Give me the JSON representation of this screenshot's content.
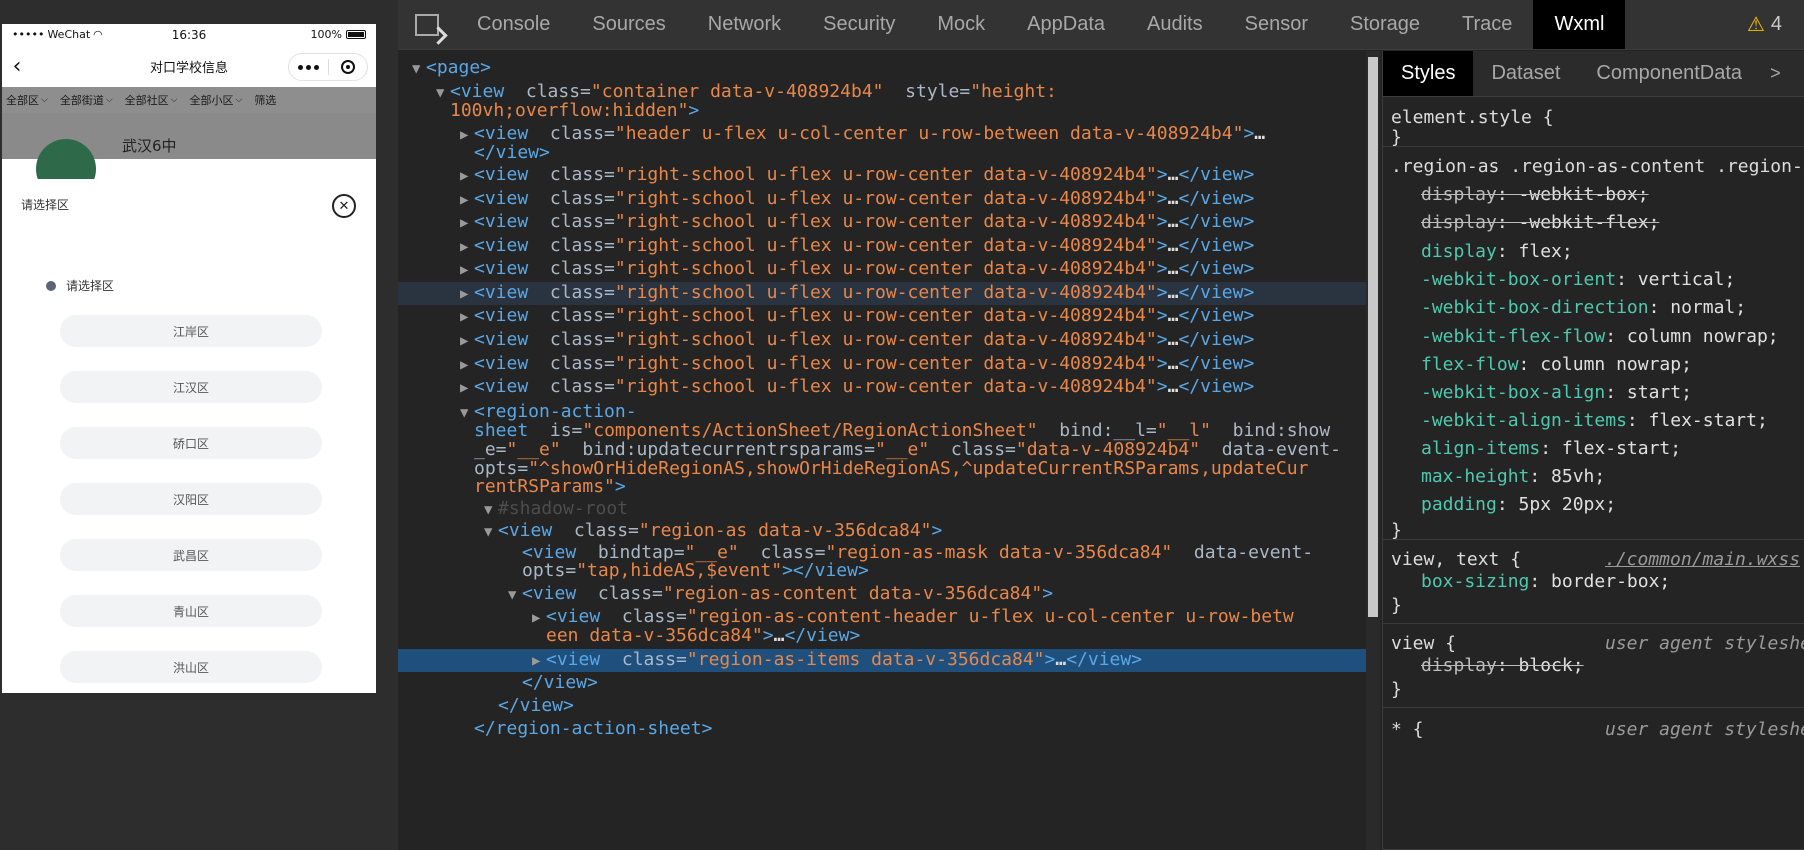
{
  "phone": {
    "status": {
      "carrier": "WeChat",
      "time": "16:36",
      "battery": "100%"
    },
    "nav": {
      "back": "‹",
      "title": "对口学校信息"
    },
    "filters": [
      "全部区",
      "全部街道",
      "全部社区",
      "全部小区",
      "筛选"
    ],
    "school_name": "武汉6中",
    "sheet": {
      "title": "请选择区",
      "close": "✕",
      "subtitle": "请选择区",
      "items": [
        "江岸区",
        "江汉区",
        "硚口区",
        "汉阳区",
        "武昌区",
        "青山区",
        "洪山区"
      ]
    }
  },
  "devtools": {
    "tabs": [
      "Console",
      "Sources",
      "Network",
      "Security",
      "Mock",
      "AppData",
      "Audits",
      "Sensor",
      "Storage",
      "Trace",
      "Wxml"
    ],
    "active_tab": "Wxml",
    "warnings": "4",
    "tree": [
      {
        "tri": "▼",
        "indent": 0,
        "parts": [
          [
            "tg",
            "<page>"
          ]
        ]
      },
      {
        "tri": "▼",
        "indent": 1,
        "parts": [
          [
            "tg",
            "<view "
          ],
          [
            "an",
            " class="
          ],
          [
            "av",
            "\"container data-v-408924b4\""
          ],
          [
            "an",
            "  style="
          ],
          [
            "av",
            "\"height:"
          ]
        ]
      },
      {
        "tri": "",
        "indent": 1,
        "parts": [
          [
            "av",
            "100vh;overflow:hidden\""
          ],
          [
            "tg",
            ">"
          ]
        ]
      },
      {
        "tri": "▶",
        "indent": 2,
        "parts": [
          [
            "tg",
            "<view "
          ],
          [
            "an",
            " class="
          ],
          [
            "av",
            "\"header u-flex u-col-center u-row-between data-v-408924b4\""
          ],
          [
            "tg",
            ">"
          ],
          [
            "el",
            "…"
          ]
        ]
      },
      {
        "tri": "",
        "indent": 2,
        "parts": [
          [
            "tg",
            "</view>"
          ]
        ]
      },
      {
        "tri": "▶",
        "indent": 2,
        "parts": [
          [
            "tg",
            "<view "
          ],
          [
            "an",
            " class="
          ],
          [
            "av",
            "\"right-school u-flex u-row-center data-v-408924b4\""
          ],
          [
            "tg",
            ">"
          ],
          [
            "el",
            "…"
          ],
          [
            "tg",
            "</view>"
          ]
        ]
      },
      {
        "tri": "▶",
        "indent": 2,
        "parts": [
          [
            "tg",
            "<view "
          ],
          [
            "an",
            " class="
          ],
          [
            "av",
            "\"right-school u-flex u-row-center data-v-408924b4\""
          ],
          [
            "tg",
            ">"
          ],
          [
            "el",
            "…"
          ],
          [
            "tg",
            "</view>"
          ]
        ]
      },
      {
        "tri": "▶",
        "indent": 2,
        "parts": [
          [
            "tg",
            "<view "
          ],
          [
            "an",
            " class="
          ],
          [
            "av",
            "\"right-school u-flex u-row-center data-v-408924b4\""
          ],
          [
            "tg",
            ">"
          ],
          [
            "el",
            "…"
          ],
          [
            "tg",
            "</view>"
          ]
        ]
      },
      {
        "tri": "▶",
        "indent": 2,
        "parts": [
          [
            "tg",
            "<view "
          ],
          [
            "an",
            " class="
          ],
          [
            "av",
            "\"right-school u-flex u-row-center data-v-408924b4\""
          ],
          [
            "tg",
            ">"
          ],
          [
            "el",
            "…"
          ],
          [
            "tg",
            "</view>"
          ]
        ]
      },
      {
        "tri": "▶",
        "indent": 2,
        "parts": [
          [
            "tg",
            "<view "
          ],
          [
            "an",
            " class="
          ],
          [
            "av",
            "\"right-school u-flex u-row-center data-v-408924b4\""
          ],
          [
            "tg",
            ">"
          ],
          [
            "el",
            "…"
          ],
          [
            "tg",
            "</view>"
          ]
        ]
      },
      {
        "tri": "▶",
        "indent": 2,
        "hover": true,
        "parts": [
          [
            "tg",
            "<view "
          ],
          [
            "an",
            " class="
          ],
          [
            "av",
            "\"right-school u-flex u-row-center data-v-408924b4\""
          ],
          [
            "tg",
            ">"
          ],
          [
            "el",
            "…"
          ],
          [
            "tg",
            "</view>"
          ]
        ]
      },
      {
        "tri": "▶",
        "indent": 2,
        "parts": [
          [
            "tg",
            "<view "
          ],
          [
            "an",
            " class="
          ],
          [
            "av",
            "\"right-school u-flex u-row-center data-v-408924b4\""
          ],
          [
            "tg",
            ">"
          ],
          [
            "el",
            "…"
          ],
          [
            "tg",
            "</view>"
          ]
        ]
      },
      {
        "tri": "▶",
        "indent": 2,
        "parts": [
          [
            "tg",
            "<view "
          ],
          [
            "an",
            " class="
          ],
          [
            "av",
            "\"right-school u-flex u-row-center data-v-408924b4\""
          ],
          [
            "tg",
            ">"
          ],
          [
            "el",
            "…"
          ],
          [
            "tg",
            "</view>"
          ]
        ]
      },
      {
        "tri": "▶",
        "indent": 2,
        "parts": [
          [
            "tg",
            "<view "
          ],
          [
            "an",
            " class="
          ],
          [
            "av",
            "\"right-school u-flex u-row-center data-v-408924b4\""
          ],
          [
            "tg",
            ">"
          ],
          [
            "el",
            "…"
          ],
          [
            "tg",
            "</view>"
          ]
        ]
      },
      {
        "tri": "▶",
        "indent": 2,
        "parts": [
          [
            "tg",
            "<view "
          ],
          [
            "an",
            " class="
          ],
          [
            "av",
            "\"right-school u-flex u-row-center data-v-408924b4\""
          ],
          [
            "tg",
            ">"
          ],
          [
            "el",
            "…"
          ],
          [
            "tg",
            "</view>"
          ]
        ]
      },
      {
        "tri": "▼",
        "indent": 2,
        "parts": [
          [
            "tg",
            "<region-action-"
          ]
        ]
      },
      {
        "tri": "",
        "indent": 2,
        "parts": [
          [
            "tg",
            "sheet "
          ],
          [
            "an",
            " is="
          ],
          [
            "av",
            "\"components/ActionSheet/RegionActionSheet\""
          ],
          [
            "an",
            "  bind:__l="
          ],
          [
            "av",
            "\"__l\""
          ],
          [
            "an",
            "  bind:show"
          ]
        ]
      },
      {
        "tri": "",
        "indent": 2,
        "parts": [
          [
            "an",
            "_e="
          ],
          [
            "av",
            "\"__e\""
          ],
          [
            "an",
            "  bind:updatecurrentrsparams="
          ],
          [
            "av",
            "\"__e\""
          ],
          [
            "an",
            "  class="
          ],
          [
            "av",
            "\"data-v-408924b4\""
          ],
          [
            "an",
            "  data-event-"
          ]
        ]
      },
      {
        "tri": "",
        "indent": 2,
        "parts": [
          [
            "an",
            "opts="
          ],
          [
            "av",
            "\"^showOrHideRegionAS,showOrHideRegionAS,^updateCurrentRSParams,updateCur"
          ]
        ]
      },
      {
        "tri": "",
        "indent": 2,
        "parts": [
          [
            "av",
            "rentRSParams\""
          ],
          [
            "tg",
            ">"
          ]
        ]
      },
      {
        "tri": "▼",
        "indent": 3,
        "parts": [
          [
            "shadow",
            "#shadow-root"
          ]
        ]
      },
      {
        "tri": "▼",
        "indent": 3,
        "parts": [
          [
            "tg",
            "<view "
          ],
          [
            "an",
            " class="
          ],
          [
            "av",
            "\"region-as data-v-356dca84\""
          ],
          [
            "tg",
            ">"
          ]
        ]
      },
      {
        "tri": "",
        "indent": 4,
        "parts": [
          [
            "tg",
            "<view "
          ],
          [
            "an",
            " bindtap="
          ],
          [
            "av",
            "\"__e\""
          ],
          [
            "an",
            "  class="
          ],
          [
            "av",
            "\"region-as-mask data-v-356dca84\""
          ],
          [
            "an",
            "  data-event-"
          ]
        ]
      },
      {
        "tri": "",
        "indent": 4,
        "parts": [
          [
            "an",
            "opts="
          ],
          [
            "av",
            "\"tap,hideAS,$event\""
          ],
          [
            "tg",
            "></view>"
          ]
        ]
      },
      {
        "tri": "▼",
        "indent": 4,
        "parts": [
          [
            "tg",
            "<view "
          ],
          [
            "an",
            " class="
          ],
          [
            "av",
            "\"region-as-content data-v-356dca84\""
          ],
          [
            "tg",
            ">"
          ]
        ]
      },
      {
        "tri": "▶",
        "indent": 5,
        "parts": [
          [
            "tg",
            "<view "
          ],
          [
            "an",
            " class="
          ],
          [
            "av",
            "\"region-as-content-header u-flex u-col-center u-row-betw"
          ]
        ]
      },
      {
        "tri": "",
        "indent": 5,
        "parts": [
          [
            "av",
            "een data-v-356dca84\""
          ],
          [
            "tg",
            ">"
          ],
          [
            "el",
            "…"
          ],
          [
            "tg",
            "</view>"
          ]
        ]
      },
      {
        "tri": "▶",
        "indent": 5,
        "sel": true,
        "parts": [
          [
            "tg",
            "<view "
          ],
          [
            "an",
            " class="
          ],
          [
            "av",
            "\"region-as-items data-v-356dca84\""
          ],
          [
            "tg",
            ">"
          ],
          [
            "el",
            "…"
          ],
          [
            "tg",
            "</view>"
          ]
        ]
      },
      {
        "tri": "",
        "indent": 4,
        "parts": [
          [
            "tg",
            "</view>"
          ]
        ]
      },
      {
        "tri": "",
        "indent": 3,
        "parts": [
          [
            "tg",
            "</view>"
          ]
        ]
      },
      {
        "tri": "",
        "indent": 2,
        "parts": [
          [
            "tg",
            "</region-action-sheet>"
          ]
        ]
      }
    ],
    "styles_tabs": [
      "Styles",
      "Dataset",
      "ComponentData"
    ],
    "styles_active": "Styles",
    "styles_more": ">",
    "style_blocks": [
      {
        "lines": [
          {
            "parts": [
              [
                "sel",
                "element.style {"
              ]
            ]
          },
          {
            "parts": [
              [
                "sel",
                "}"
              ]
            ]
          }
        ]
      },
      {
        "lines": [
          {
            "parts": [
              [
                "sel",
                ".region-as .region-as-content .region-as-items"
              ]
            ]
          },
          {
            "strike": true,
            "parts": [
              [
                "prop",
                "display"
              ],
              [
                "val",
                ": -webkit-box;"
              ]
            ]
          },
          {
            "strike": true,
            "parts": [
              [
                "prop",
                "display"
              ],
              [
                "val",
                ": -webkit-flex;"
              ]
            ]
          },
          {
            "parts": [
              [
                "prop",
                "display"
              ],
              [
                "val",
                ": flex;"
              ]
            ]
          },
          {
            "parts": [
              [
                "prop",
                "-webkit-box-orient"
              ],
              [
                "val",
                ": vertical;"
              ]
            ]
          },
          {
            "parts": [
              [
                "prop",
                "-webkit-box-direction"
              ],
              [
                "val",
                ": normal;"
              ]
            ]
          },
          {
            "parts": [
              [
                "prop",
                "-webkit-flex-flow"
              ],
              [
                "val",
                ": column nowrap;"
              ]
            ]
          },
          {
            "parts": [
              [
                "prop",
                "flex-flow"
              ],
              [
                "val",
                ": column nowrap;"
              ]
            ]
          },
          {
            "parts": [
              [
                "prop",
                "-webkit-box-align"
              ],
              [
                "val",
                ": start;"
              ]
            ]
          },
          {
            "parts": [
              [
                "prop",
                "-webkit-align-items"
              ],
              [
                "val",
                ": flex-start;"
              ]
            ]
          },
          {
            "parts": [
              [
                "prop",
                "align-items"
              ],
              [
                "val",
                ": flex-start;"
              ]
            ]
          },
          {
            "parts": [
              [
                "prop",
                "max-height"
              ],
              [
                "val",
                ": 85vh;"
              ]
            ]
          },
          {
            "parts": [
              [
                "prop",
                "padding"
              ],
              [
                "val",
                ": 5px 20px;"
              ]
            ]
          },
          {
            "parts": [
              [
                "sel",
                "}"
              ]
            ]
          }
        ]
      },
      {
        "lines": [
          {
            "parts": [
              [
                "sel",
                "view, text {"
              ]
            ],
            "src": "./common/main.wxss",
            "src_link": true
          },
          {
            "parts": [
              [
                "prop",
                "box-sizing"
              ],
              [
                "val",
                ": border-box;"
              ]
            ]
          },
          {
            "parts": [
              [
                "sel",
                "}"
              ]
            ]
          }
        ]
      },
      {
        "lines": [
          {
            "parts": [
              [
                "sel",
                "view {"
              ]
            ],
            "src": "user agent stylesheet"
          },
          {
            "strike": true,
            "parts": [
              [
                "prop",
                "display"
              ],
              [
                "val",
                ": block;"
              ]
            ]
          },
          {
            "parts": [
              [
                "sel",
                "}"
              ]
            ]
          }
        ]
      },
      {
        "lines": [
          {
            "parts": [
              [
                "sel",
                "* {"
              ]
            ],
            "src": "user agent stylesheet"
          }
        ]
      }
    ]
  }
}
